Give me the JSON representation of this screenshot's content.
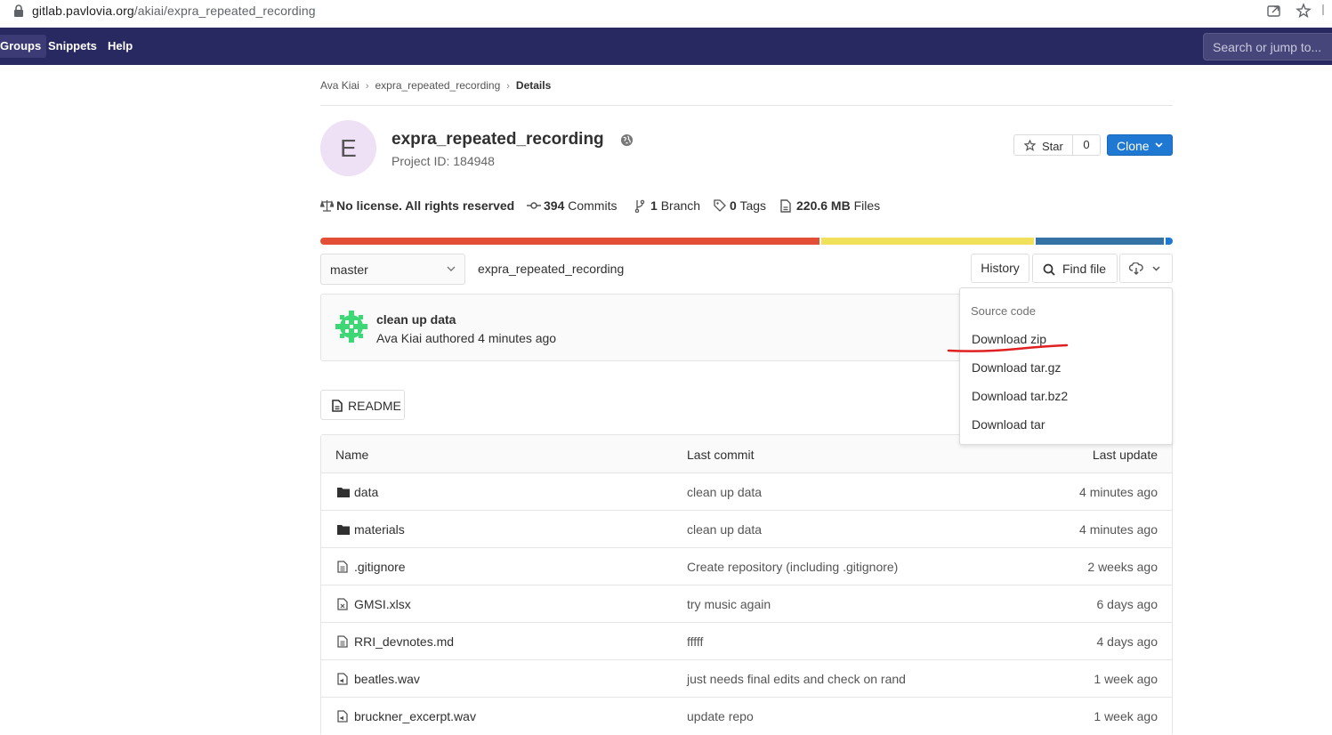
{
  "browser": {
    "url_host": "gitlab.pavlovia.org",
    "url_path": "/akiai/expra_repeated_recording"
  },
  "topnav": {
    "items": [
      {
        "label": "Groups"
      },
      {
        "label": "Snippets"
      },
      {
        "label": "Help"
      }
    ],
    "search_placeholder": "Search or jump to..."
  },
  "breadcrumb": {
    "items": [
      "Ava Kiai",
      "expra_repeated_recording"
    ],
    "current": "Details"
  },
  "project": {
    "avatar_letter": "E",
    "avatar_color": "#eee0f5",
    "title": "expra_repeated_recording",
    "id_label": "Project ID: 184948",
    "star_label": "Star",
    "star_count": "0",
    "clone_label": "Clone"
  },
  "stats": {
    "license": "No license. All rights reserved",
    "commits_count": "394",
    "commits_label": "Commits",
    "branches_count": "1",
    "branches_label": "Branch",
    "tags_count": "0",
    "tags_label": "Tags",
    "files_size": "220.6 MB",
    "files_label": "Files"
  },
  "language_bar": {
    "colors": [
      "#e24f34",
      "#f1e05a",
      "#3572a5",
      "#1f78d1"
    ]
  },
  "repo": {
    "branch": "master",
    "path": "expra_repeated_recording",
    "history_label": "History",
    "find_file_label": "Find file"
  },
  "last_commit": {
    "title": "clean up data",
    "meta": "Ava Kiai authored 4 minutes ago"
  },
  "readme_label": "README",
  "table": {
    "headers": {
      "name": "Name",
      "commit": "Last commit",
      "update": "Last update"
    },
    "rows": [
      {
        "icon": "folder-icon",
        "name": "data",
        "commit": "clean up data",
        "update": "4 minutes ago"
      },
      {
        "icon": "folder-icon",
        "name": "materials",
        "commit": "clean up data",
        "update": "4 minutes ago"
      },
      {
        "icon": "file-icon",
        "name": ".gitignore",
        "commit": "Create repository (including .gitignore)",
        "update": "2 weeks ago"
      },
      {
        "icon": "spreadsheet-file-icon",
        "name": "GMSI.xlsx",
        "commit": "try music again",
        "update": "6 days ago"
      },
      {
        "icon": "file-icon",
        "name": "RRI_devnotes.md",
        "commit": "fffff",
        "update": "4 days ago"
      },
      {
        "icon": "audio-file-icon",
        "name": "beatles.wav",
        "commit": "just needs final edits and check on rand",
        "update": "1 week ago"
      },
      {
        "icon": "audio-file-icon",
        "name": "bruckner_excerpt.wav",
        "commit": "update repo",
        "update": "1 week ago"
      }
    ]
  },
  "download_dropdown": {
    "header": "Source code",
    "items": [
      "Download zip",
      "Download tar.gz",
      "Download tar.bz2",
      "Download tar"
    ]
  },
  "colors": {
    "nav_bg": "#292961",
    "primary": "#1f78d1",
    "annotation_red": "#e02020"
  }
}
